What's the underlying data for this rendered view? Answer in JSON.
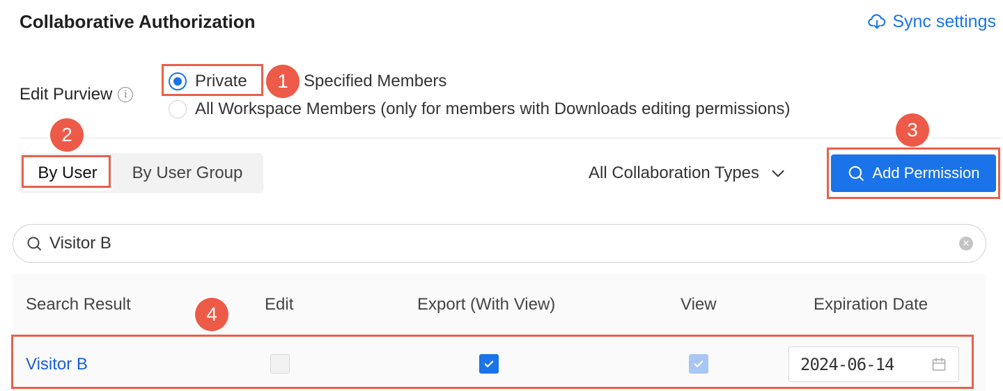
{
  "header": {
    "title": "Collaborative Authorization",
    "sync_label": "Sync settings"
  },
  "purview": {
    "label": "Edit Purview",
    "options": [
      {
        "label": "Private",
        "selected": true
      },
      {
        "label": "Specified Members",
        "selected": false
      },
      {
        "label": "All Workspace Members (only for members with Downloads editing permissions)",
        "selected": false
      }
    ]
  },
  "tabs": {
    "by_user": "By User",
    "by_user_group": "By User Group",
    "active": "By User"
  },
  "filter": {
    "types_label": "All Collaboration Types"
  },
  "add_permission_label": "Add Permission",
  "search": {
    "value": "Visitor B",
    "clear_icon": "clear-icon"
  },
  "table": {
    "headers": [
      "Search Result",
      "Edit",
      "Export (With View)",
      "View",
      "Expiration Date"
    ],
    "rows": [
      {
        "name": "Visitor B",
        "edit": false,
        "export": true,
        "view": true,
        "view_disabled": true,
        "expiration": "2024-06-14"
      }
    ]
  },
  "callouts": [
    "1",
    "2",
    "3",
    "4"
  ],
  "colors": {
    "accent": "#1a73e8",
    "highlight": "#e8604c",
    "badge": "#ee5a48"
  }
}
